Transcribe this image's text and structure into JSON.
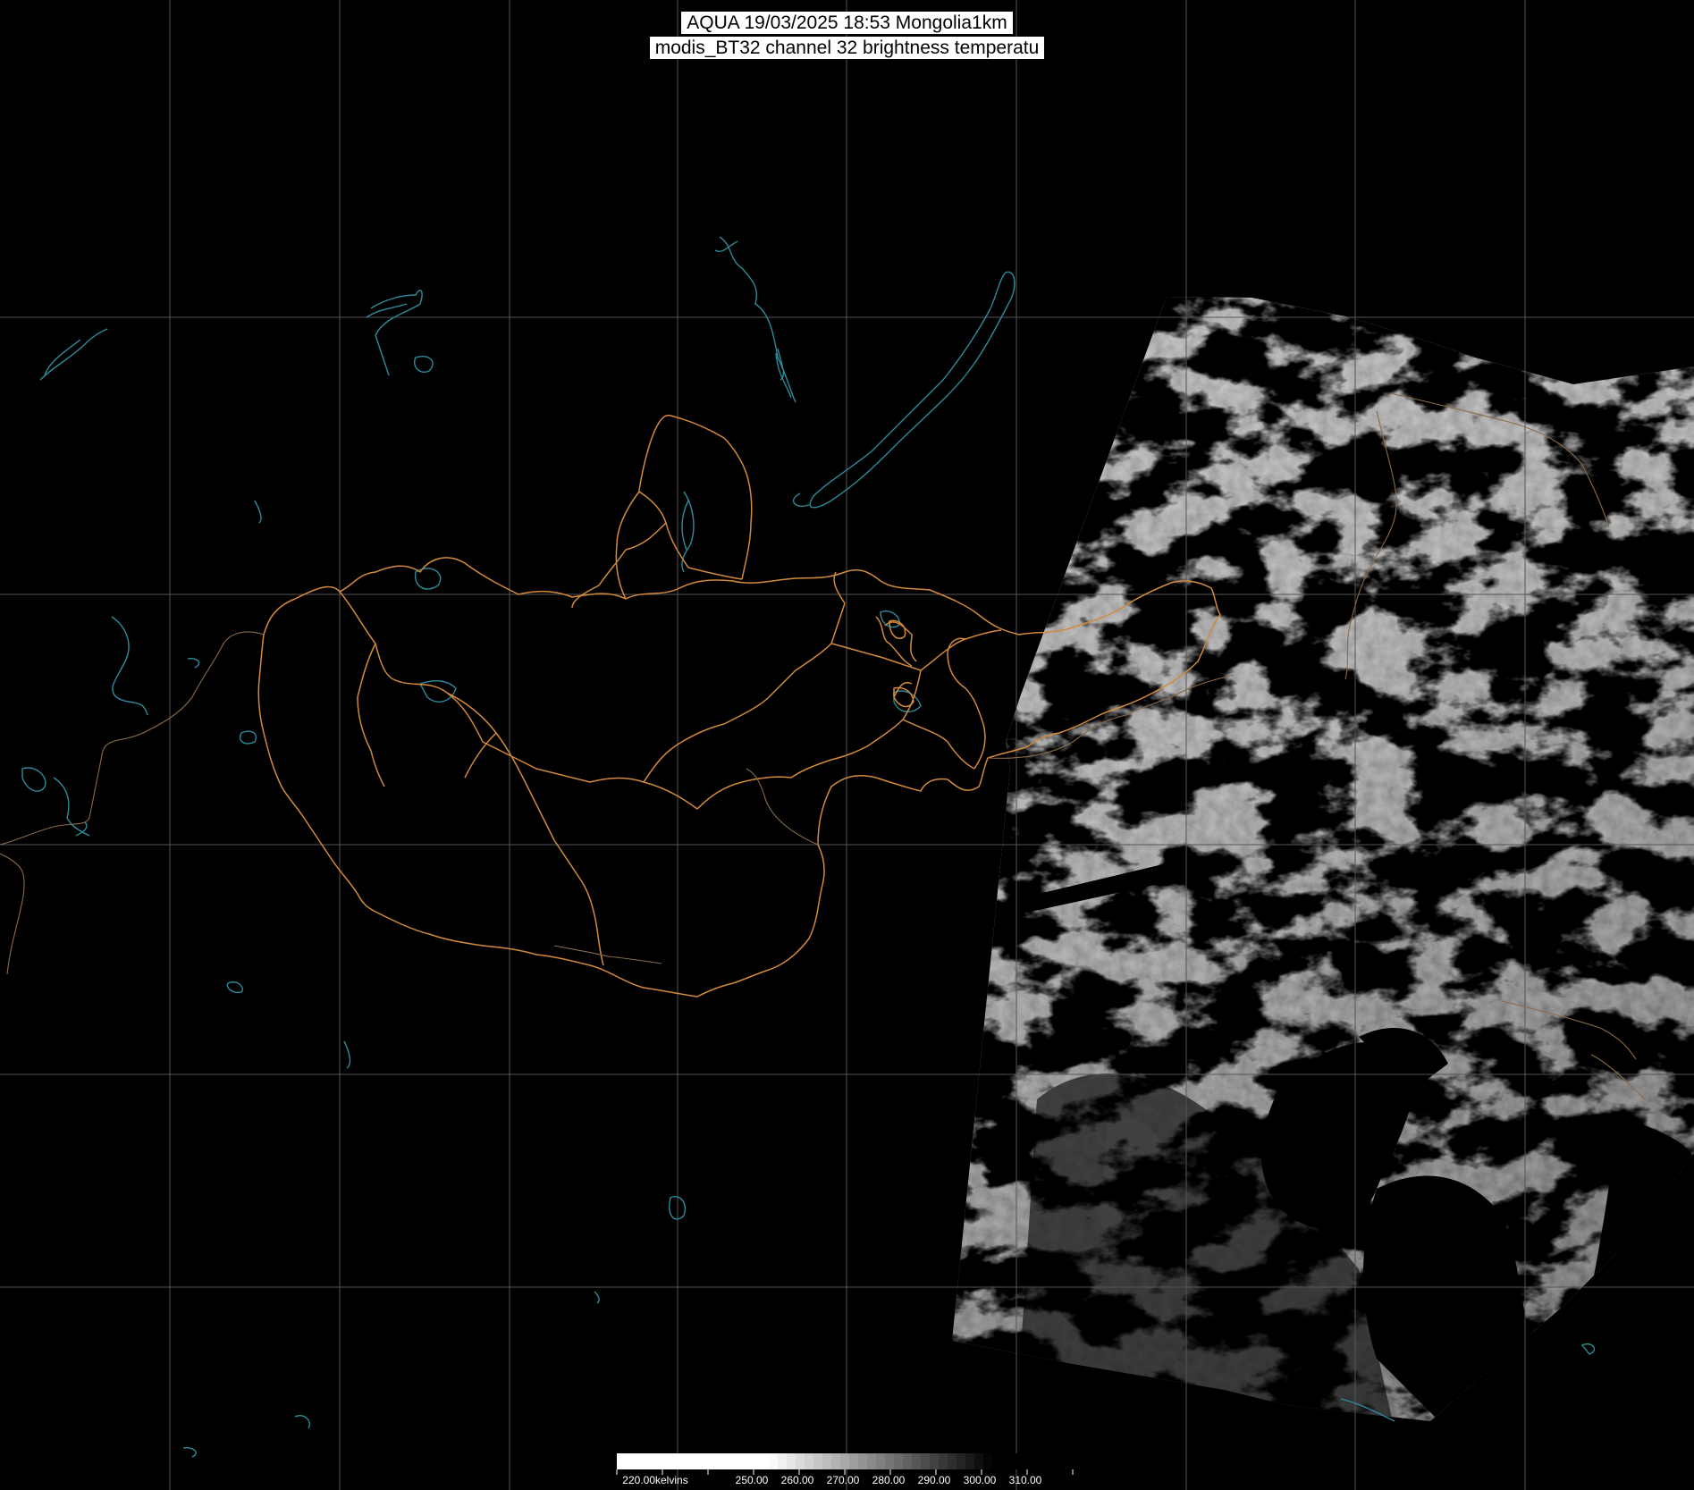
{
  "title": {
    "line1": "AQUA 19/03/2025 18:53 Mongolia1km",
    "line2": "modis_BT32 channel 32 brightness temperatu"
  },
  "colors": {
    "background": "#000000",
    "graticule": "#555555",
    "province_border": "#d28a3c",
    "country_border": "#d28a3c",
    "water": "#2e8a9a",
    "image_gray_dark": "#2a2a2a",
    "image_gray_light": "#d8d8d8"
  },
  "colorbar": {
    "unit_label": "220.00kelvins",
    "ticks": [
      "250.00",
      "260.00",
      "270.00",
      "280.00",
      "290.00",
      "300.00",
      "310.00"
    ],
    "range_kelvin": [
      220,
      320
    ]
  }
}
